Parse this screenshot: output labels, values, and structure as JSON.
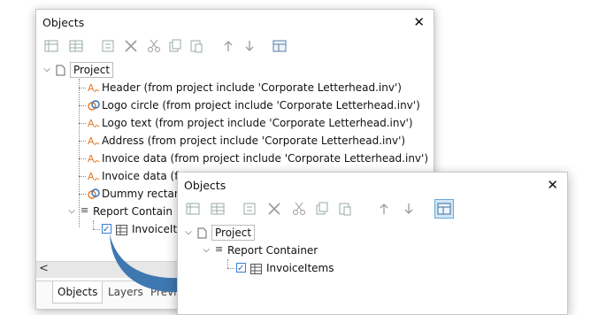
{
  "colors": {
    "accent": "#3f77b0",
    "icon_orange": "#e87722",
    "icon_blue": "#2f6db5",
    "selected_bg": "#cfe6f7"
  },
  "panel1": {
    "title": "Objects",
    "close_icon": "✕",
    "toolbar": [
      "new-icon",
      "table-icon",
      "properties-icon",
      "delete-icon",
      "cut-icon",
      "copy-icon",
      "paste-icon",
      "up-icon",
      "down-icon",
      "display-icon"
    ],
    "tree": {
      "root": "Project",
      "items": [
        "Header (from project include 'Corporate Letterhead.inv')",
        "Logo circle (from project include 'Corporate Letterhead.inv')",
        "Logo text (from project include 'Corporate Letterhead.inv')",
        "Address (from project include 'Corporate Letterhead.inv')",
        "Invoice data (from project include 'Corporate Letterhead.inv')",
        "Invoice data (fr",
        "Dummy rectan",
        "Report Contain",
        "InvoiceIt"
      ]
    },
    "scroll_left": "<",
    "tabs": [
      "Objects",
      "Layers",
      "Previ"
    ]
  },
  "panel2": {
    "title": "Objects",
    "close_icon": "✕",
    "tree": {
      "root": "Project",
      "container": "Report Container",
      "child": "InvoiceItems"
    }
  }
}
